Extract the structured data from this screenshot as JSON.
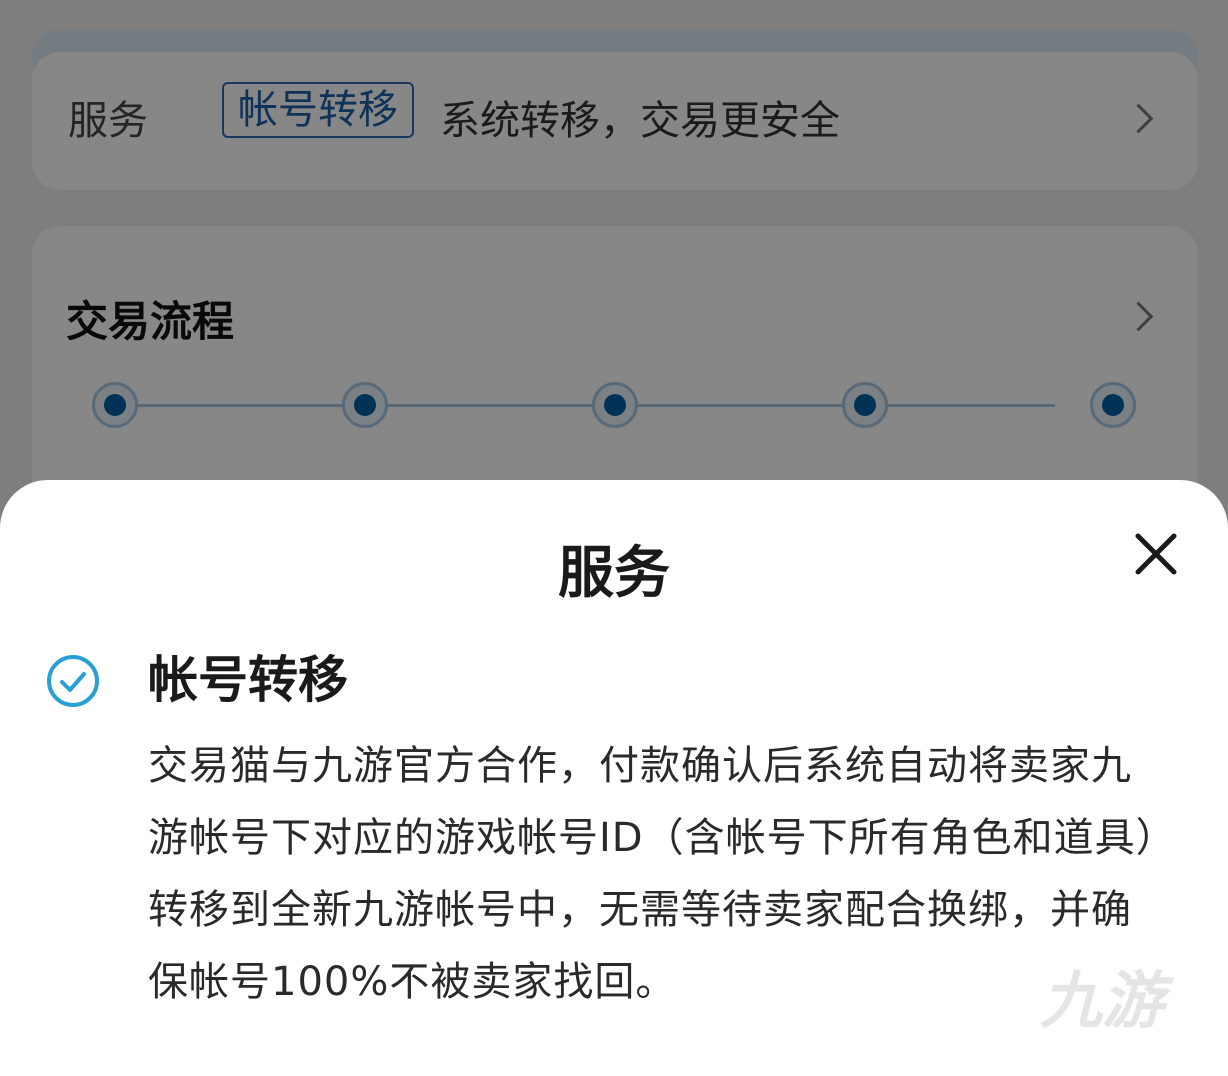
{
  "background": {
    "service_label": "服务",
    "service_tag": "帐号转移",
    "service_desc": "系统转移，交易更安全",
    "flow_title": "交易流程",
    "flow_steps": [
      "",
      "",
      "",
      "",
      ""
    ]
  },
  "sheet": {
    "title": "服务",
    "option_title": "帐号转移",
    "option_desc": "交易猫与九游官方合作，付款确认后系统自动将卖家九游帐号下对应的游戏帐号ID（含帐号下所有角色和道具）转移到全新九游帐号中，无需等待卖家配合换绑，并确保帐号100%不被卖家找回。",
    "watermark": "九游"
  },
  "colors": {
    "accent": "#2a9fd6",
    "tag_border": "#2f6db3",
    "flow_node": "#005fa0",
    "overlay": "rgba(0,0,0,0.47)"
  },
  "icons": {
    "close": "close-icon",
    "check": "check-circle-icon",
    "chevron": "chevron-right-icon"
  }
}
